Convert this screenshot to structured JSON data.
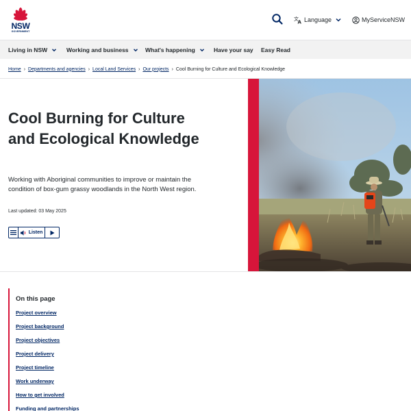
{
  "header": {
    "logo_text": "NSW",
    "logo_subtext": "GOVERNMENT",
    "search_icon": "search-icon",
    "language_label": "Language",
    "myservice_label": "MyServiceNSW",
    "brand_color": "#002664",
    "accent_color": "#d7153a"
  },
  "nav": {
    "items": [
      {
        "label": "Living in NSW",
        "has_dropdown": true
      },
      {
        "label": "Working and business",
        "has_dropdown": true
      },
      {
        "label": "What's happening",
        "has_dropdown": true
      },
      {
        "label": "Have your say",
        "has_dropdown": false
      },
      {
        "label": "Easy Read",
        "has_dropdown": false
      }
    ]
  },
  "breadcrumb": {
    "links": [
      "Home",
      "Departments and agencies",
      "Local Land Services",
      "Our projects"
    ],
    "current": "Cool Burning for Culture and Ecological Knowledge"
  },
  "hero": {
    "title": "Cool Burning for Culture and Ecological Knowledge",
    "intro": "Working with Aboriginal communities to improve or maintain the condition of box-gum grassy woodlands in the North West region.",
    "last_updated": "Last updated: 03 May 2025",
    "listen_label": "Listen"
  },
  "on_this_page": {
    "title": "On this page",
    "links": [
      "Project overview",
      "Project background",
      "Project objectives",
      "Project delivery",
      "Project timeline",
      "Work underway",
      "How to get involved",
      "Funding and partnerships"
    ]
  }
}
